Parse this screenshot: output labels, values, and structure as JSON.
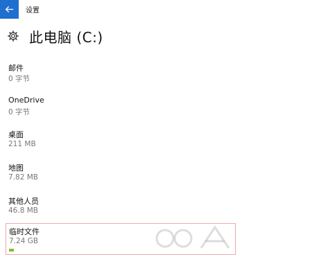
{
  "window": {
    "title": "设置",
    "back_icon": "back-arrow-icon"
  },
  "header": {
    "title": "此电脑 (C:)",
    "icon": "gear-icon"
  },
  "items": [
    {
      "name": "邮件",
      "size": "0 字节"
    },
    {
      "name": "OneDrive",
      "size": "0 字节"
    },
    {
      "name": "桌面",
      "size": "211 MB"
    },
    {
      "name": "地图",
      "size": "7.82 MB"
    },
    {
      "name": "其他人员",
      "size": "46.8 MB"
    }
  ],
  "selected_item": {
    "name": "临时文件",
    "size": "7.24 GB",
    "usage_fraction": 0.02,
    "bar_color": "#7fbf30"
  },
  "colors": {
    "accent": "#1f6fd1",
    "selection_border": "#f0a9a9"
  }
}
